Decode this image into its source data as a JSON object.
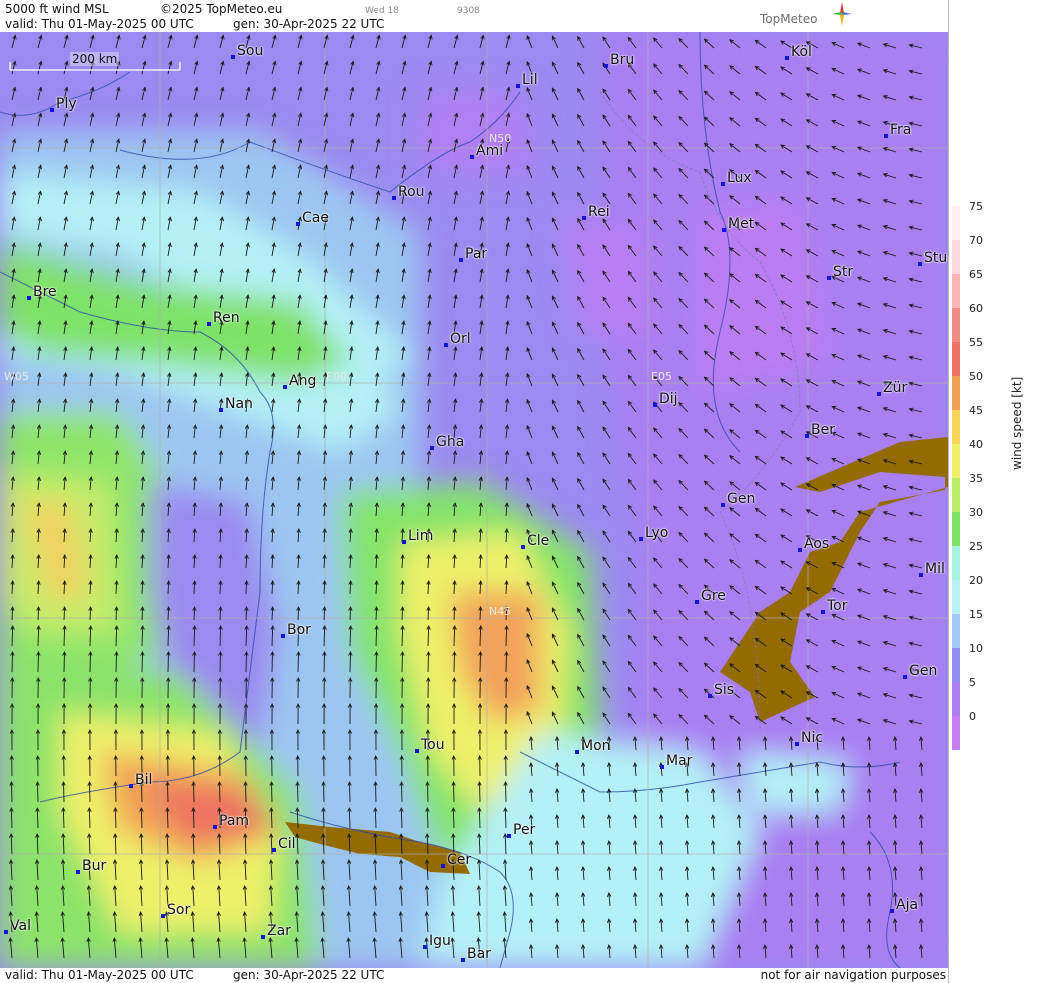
{
  "header": {
    "layer": "5000 ft wind MSL",
    "copyright": "©2025 TopMeteo.eu",
    "valid": "valid:  Thu  01-May-2025  00 UTC",
    "generated": "gen:  30-Apr-2025 22 UTC",
    "tag_day": "Wed 18",
    "tag_code": "9308",
    "logo": "TopMeteo"
  },
  "footer": {
    "valid": "valid:  Thu  01-May-2025  00 UTC",
    "generated": "gen:  30-Apr-2025 22 UTC",
    "disclaimer": "not for air navigation purposes"
  },
  "scale_bar": "200 km",
  "grid_labels": [
    "N50",
    "N45",
    "W05",
    "E00",
    "E05"
  ],
  "legend": {
    "title": "wind speed [kt]",
    "ticks": [
      "75",
      "70",
      "65",
      "60",
      "55",
      "50",
      "45",
      "40",
      "35",
      "30",
      "25",
      "20",
      "15",
      "10",
      "5",
      "0"
    ],
    "colors": [
      "#fdeef0",
      "#fbd8dc",
      "#f7b5b5",
      "#f18b86",
      "#ed7264",
      "#f2a154",
      "#f7d45c",
      "#eef06a",
      "#b9ec67",
      "#7ee267",
      "#a7f3df",
      "#b9f1f8",
      "#a5c8f2",
      "#8f8cf2",
      "#ad7ef2",
      "#c77cf2"
    ]
  },
  "cities": [
    {
      "name": "Sou"
    },
    {
      "name": "Bru"
    },
    {
      "name": "Köl"
    },
    {
      "name": "Lil"
    },
    {
      "name": "Ply"
    },
    {
      "name": "Ami"
    },
    {
      "name": "Fra"
    },
    {
      "name": "Lux"
    },
    {
      "name": "Rou"
    },
    {
      "name": "Cae"
    },
    {
      "name": "Rei"
    },
    {
      "name": "Met"
    },
    {
      "name": "Par"
    },
    {
      "name": "Stu"
    },
    {
      "name": "Str"
    },
    {
      "name": "Bre"
    },
    {
      "name": "Ren"
    },
    {
      "name": "Orl"
    },
    {
      "name": "Ang"
    },
    {
      "name": "Dij"
    },
    {
      "name": "Zür"
    },
    {
      "name": "Nan"
    },
    {
      "name": "Ber"
    },
    {
      "name": "Gha"
    },
    {
      "name": "Gen"
    },
    {
      "name": "Lim"
    },
    {
      "name": "Cle"
    },
    {
      "name": "Lyo"
    },
    {
      "name": "Aos"
    },
    {
      "name": "Mil"
    },
    {
      "name": "Gre"
    },
    {
      "name": "Tor"
    },
    {
      "name": "Bor"
    },
    {
      "name": "Gen"
    },
    {
      "name": "Sis"
    },
    {
      "name": "Tou"
    },
    {
      "name": "Mon"
    },
    {
      "name": "Nic"
    },
    {
      "name": "Mar"
    },
    {
      "name": "Bil"
    },
    {
      "name": "Pam"
    },
    {
      "name": "Per"
    },
    {
      "name": "Cil"
    },
    {
      "name": "Cer"
    },
    {
      "name": "Bur"
    },
    {
      "name": "Sor"
    },
    {
      "name": "Aja"
    },
    {
      "name": "Val"
    },
    {
      "name": "Zar"
    },
    {
      "name": "Igu"
    },
    {
      "name": "Bar"
    }
  ]
}
